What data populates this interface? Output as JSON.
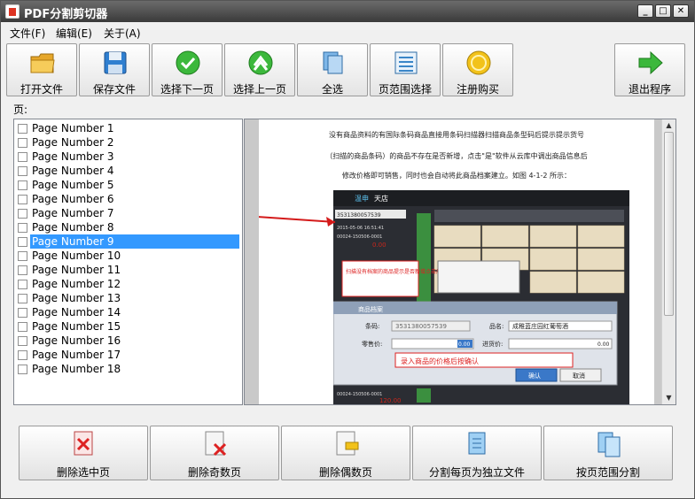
{
  "window": {
    "title": "PDF分割剪切器",
    "controls": [
      "_",
      "□",
      "✕"
    ]
  },
  "menu": [
    "文件(F)",
    "编辑(E)",
    "关于(A)"
  ],
  "toolbar": [
    {
      "label": "打开文件",
      "icon": "folder-icon"
    },
    {
      "label": "保存文件",
      "icon": "floppy-icon"
    },
    {
      "label": "选择下一页",
      "icon": "check-down-icon"
    },
    {
      "label": "选择上一页",
      "icon": "up-arrow-icon"
    },
    {
      "label": "全选",
      "icon": "pages-icon"
    },
    {
      "label": "页范围选择",
      "icon": "range-icon"
    },
    {
      "label": "注册购买",
      "icon": "coin-icon"
    },
    {
      "label": "退出程序",
      "icon": "exit-arrow-icon"
    }
  ],
  "pages_label": "页:",
  "pages": [
    "Page Number 1",
    "Page Number 2",
    "Page Number 3",
    "Page Number 4",
    "Page Number 5",
    "Page Number 6",
    "Page Number 7",
    "Page Number 8",
    "Page Number 9",
    "Page Number 10",
    "Page Number 11",
    "Page Number 12",
    "Page Number 13",
    "Page Number 14",
    "Page Number 15",
    "Page Number 16",
    "Page Number 17",
    "Page Number 18"
  ],
  "selected_page": "Page Number 9",
  "preview": {
    "lines": [
      "没有商品资料的有国际条码商品直接用条码扫描器扫描商品条型码后提示提示货号",
      "（扫描的商品条码）的商品不存在是否新增，点击\"是\"软件从云库中调出商品信息后",
      "修改价格即可销售，同时也会自动将此商品档案建立。如图 4-1-2 所示："
    ],
    "shot": {
      "dialog_title": "商品档案",
      "barcode_label": "条码:",
      "barcode_value": "3531380057539",
      "name_label": "品名:",
      "name_value": "成稚蓝庄园红葡萄酒",
      "retail_label": "零售价:",
      "retail_value": "0.00",
      "cost_label": "进货价:",
      "cost_value": "0.00",
      "hint": "录入商品的价格后按确认",
      "confirm": "确认",
      "cancel": "取消",
      "annotation": "扫描没有档案的商品提示是否新增点击后选是",
      "logo_a": "温申",
      "logo_b": "天店",
      "top_code": "3531380057539",
      "side_date": "2015-05-06 16:51:41",
      "order_a": "00024-150506-0001",
      "price_a": "0.00",
      "order_b": "00024-150506-0001",
      "price_b": "120.00",
      "order_c": "00024-150506-0001"
    }
  },
  "bottom": [
    {
      "label": "删除选中页",
      "icon": "delete-page-icon"
    },
    {
      "label": "删除奇数页",
      "icon": "delete-odd-icon"
    },
    {
      "label": "删除偶数页",
      "icon": "delete-even-icon"
    },
    {
      "label": "分割每页为独立文件",
      "icon": "split-icon"
    },
    {
      "label": "按页范围分割",
      "icon": "range-split-icon"
    }
  ],
  "colors": {
    "selection": "#3399ff",
    "titlebar": "#4a4a4a",
    "arrow": "#d41a1a"
  }
}
